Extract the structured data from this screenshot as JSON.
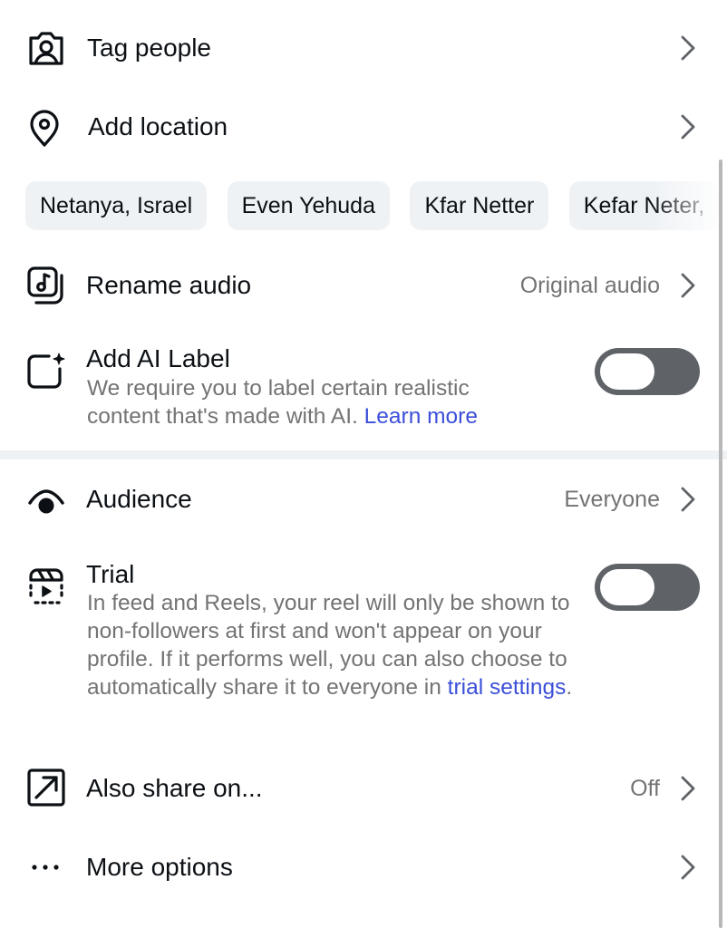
{
  "tag_people": {
    "label": "Tag people",
    "icon": "tag-people-icon"
  },
  "add_location": {
    "label": "Add location",
    "icon": "location-pin-icon",
    "suggestions": [
      "Netanya, Israel",
      "Even Yehuda",
      "Kfar Netter",
      "Kefar Neter, "
    ]
  },
  "rename_audio": {
    "label": "Rename audio",
    "value": "Original audio",
    "icon": "audio-icon"
  },
  "ai_label": {
    "label": "Add AI Label",
    "description": "We require you to label certain realistic content that's made with AI.",
    "link": "Learn more",
    "enabled": false,
    "icon": "ai-label-icon"
  },
  "audience": {
    "label": "Audience",
    "value": "Everyone",
    "icon": "audience-icon"
  },
  "trial": {
    "label": "Trial",
    "description": "In feed and Reels, your reel will only be shown to non-followers at first and won't appear on your profile. If it performs well, you can also choose to automatically share it to everyone in",
    "link": "trial settings",
    "suffix": ".",
    "enabled": false,
    "icon": "trial-reel-icon"
  },
  "also_share": {
    "label": "Also share on...",
    "value": "Off",
    "icon": "share-arrow-icon"
  },
  "more_options": {
    "label": "More options",
    "icon": "more-dots-icon"
  },
  "colors": {
    "link": "#3b4fd8",
    "toggle_off": "#5f6368",
    "secondary_text": "#737373"
  }
}
